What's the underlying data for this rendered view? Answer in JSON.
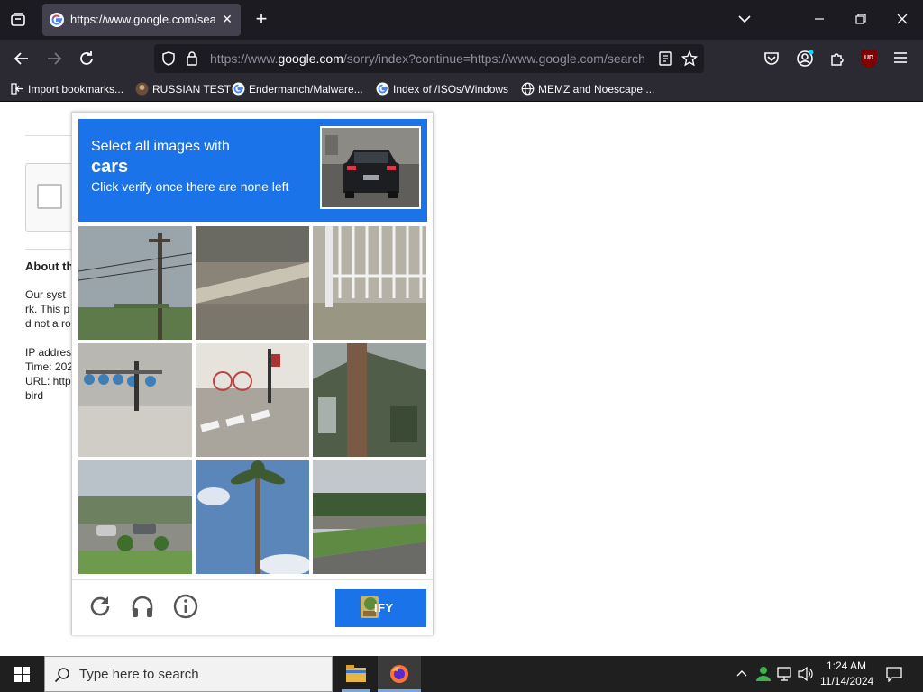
{
  "browser": {
    "tab": {
      "title": "https://www.google.com/searc",
      "close_glyph": "✕"
    },
    "new_tab_glyph": "+",
    "url": {
      "prefix": "https://www.",
      "domain": "google.com",
      "rest": "/sorry/index?continue=https://www.google.com/search"
    },
    "bookmarks": [
      {
        "label": "Import bookmarks...",
        "icon": "import-icon"
      },
      {
        "label": "RUSSIAN TEST",
        "icon": "avatar-icon"
      },
      {
        "label": "Endermanch/Malware...",
        "icon": "google-icon"
      },
      {
        "label": "Index of /ISOs/Windows",
        "icon": "google-icon"
      },
      {
        "label": "MEMZ and Noescape ...",
        "icon": "globe-icon"
      }
    ],
    "extension_badge": "UD"
  },
  "page": {
    "about_heading": "About th",
    "para": [
      "Our syst",
      "rk. This p",
      "d not a ro"
    ],
    "details": [
      "IP addres",
      "Time: 202",
      "URL: http",
      "bird"
    ]
  },
  "captcha": {
    "line1": "Select all images with",
    "target": "cars",
    "line3": "Click verify once there are none left",
    "verify_label": "IFY",
    "tiles": [
      "utility-pole-sky",
      "dirt-road-with-curb",
      "white-metal-fence",
      "bike-share-station",
      "crosswalk-with-bikes",
      "house-with-chimney",
      "road-with-parked-cars",
      "palm-tree",
      "road-with-grass-median"
    ]
  },
  "taskbar": {
    "search_placeholder": "Type here to search",
    "time": "1:24 AM",
    "date": "11/14/2024"
  },
  "colors": {
    "captcha_blue": "#1a73e8",
    "tab_bg": "#42414d",
    "chrome_dark": "#1c1b22",
    "toolbar": "#2b2a33"
  }
}
